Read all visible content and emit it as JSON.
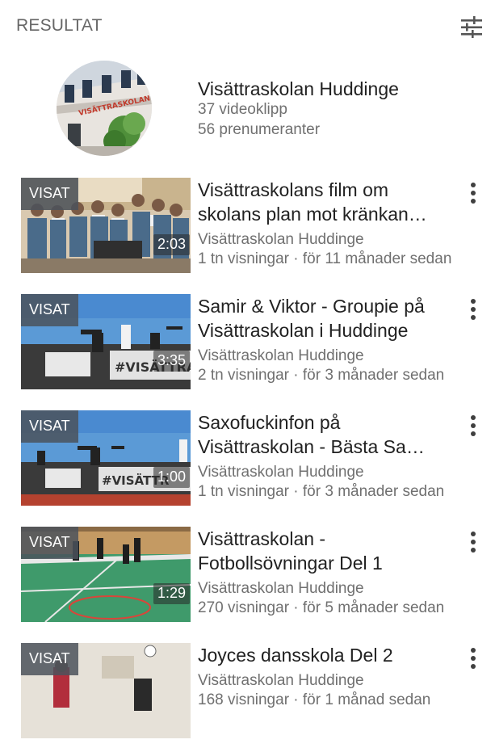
{
  "header": {
    "title": "RESULTAT",
    "filter_icon": "filter-sliders-icon"
  },
  "channel": {
    "name": "Visättraskolan Huddinge",
    "videos": "37 videoklipp",
    "subscribers": "56 prenumeranter",
    "avatar_sign_text": "VISÄTTRASKOLAN"
  },
  "videos": [
    {
      "badge": "VISAT",
      "duration": "2:03",
      "title": "Visättraskolans film om skolans plan mot kränkan…",
      "channel": "Visättraskolan Huddinge",
      "meta": "1 tn visningar · för 11 månader sedan"
    },
    {
      "badge": "VISAT",
      "duration": "3:35",
      "title": "Samir & Viktor - Groupie på Visättraskolan i Huddinge",
      "channel": "Visättraskolan Huddinge",
      "meta": "2 tn visningar · för 3 månader sedan",
      "thumb_text": "#VISÄTTRASI"
    },
    {
      "badge": "VISAT",
      "duration": "1:00",
      "title": "Saxofuckinfon på Visättraskolan - Bästa Sa…",
      "channel": "Visättraskolan Huddinge",
      "meta": "1 tn visningar · för 3 månader sedan",
      "thumb_text": "#VISÄTTR"
    },
    {
      "badge": "VISAT",
      "duration": "1:29",
      "title": "Visättraskolan - Fotbollsövningar Del 1",
      "channel": "Visättraskolan Huddinge",
      "meta": "270 visningar · för 5 månader sedan"
    },
    {
      "badge": "VISAT",
      "title": "Joyces dansskola Del 2",
      "channel": "Visättraskolan Huddinge",
      "meta": "168 visningar · för 1 månad sedan"
    }
  ],
  "colors": {
    "text_primary": "#212121",
    "text_secondary": "#707070",
    "badge_bg": "#4b525c"
  }
}
